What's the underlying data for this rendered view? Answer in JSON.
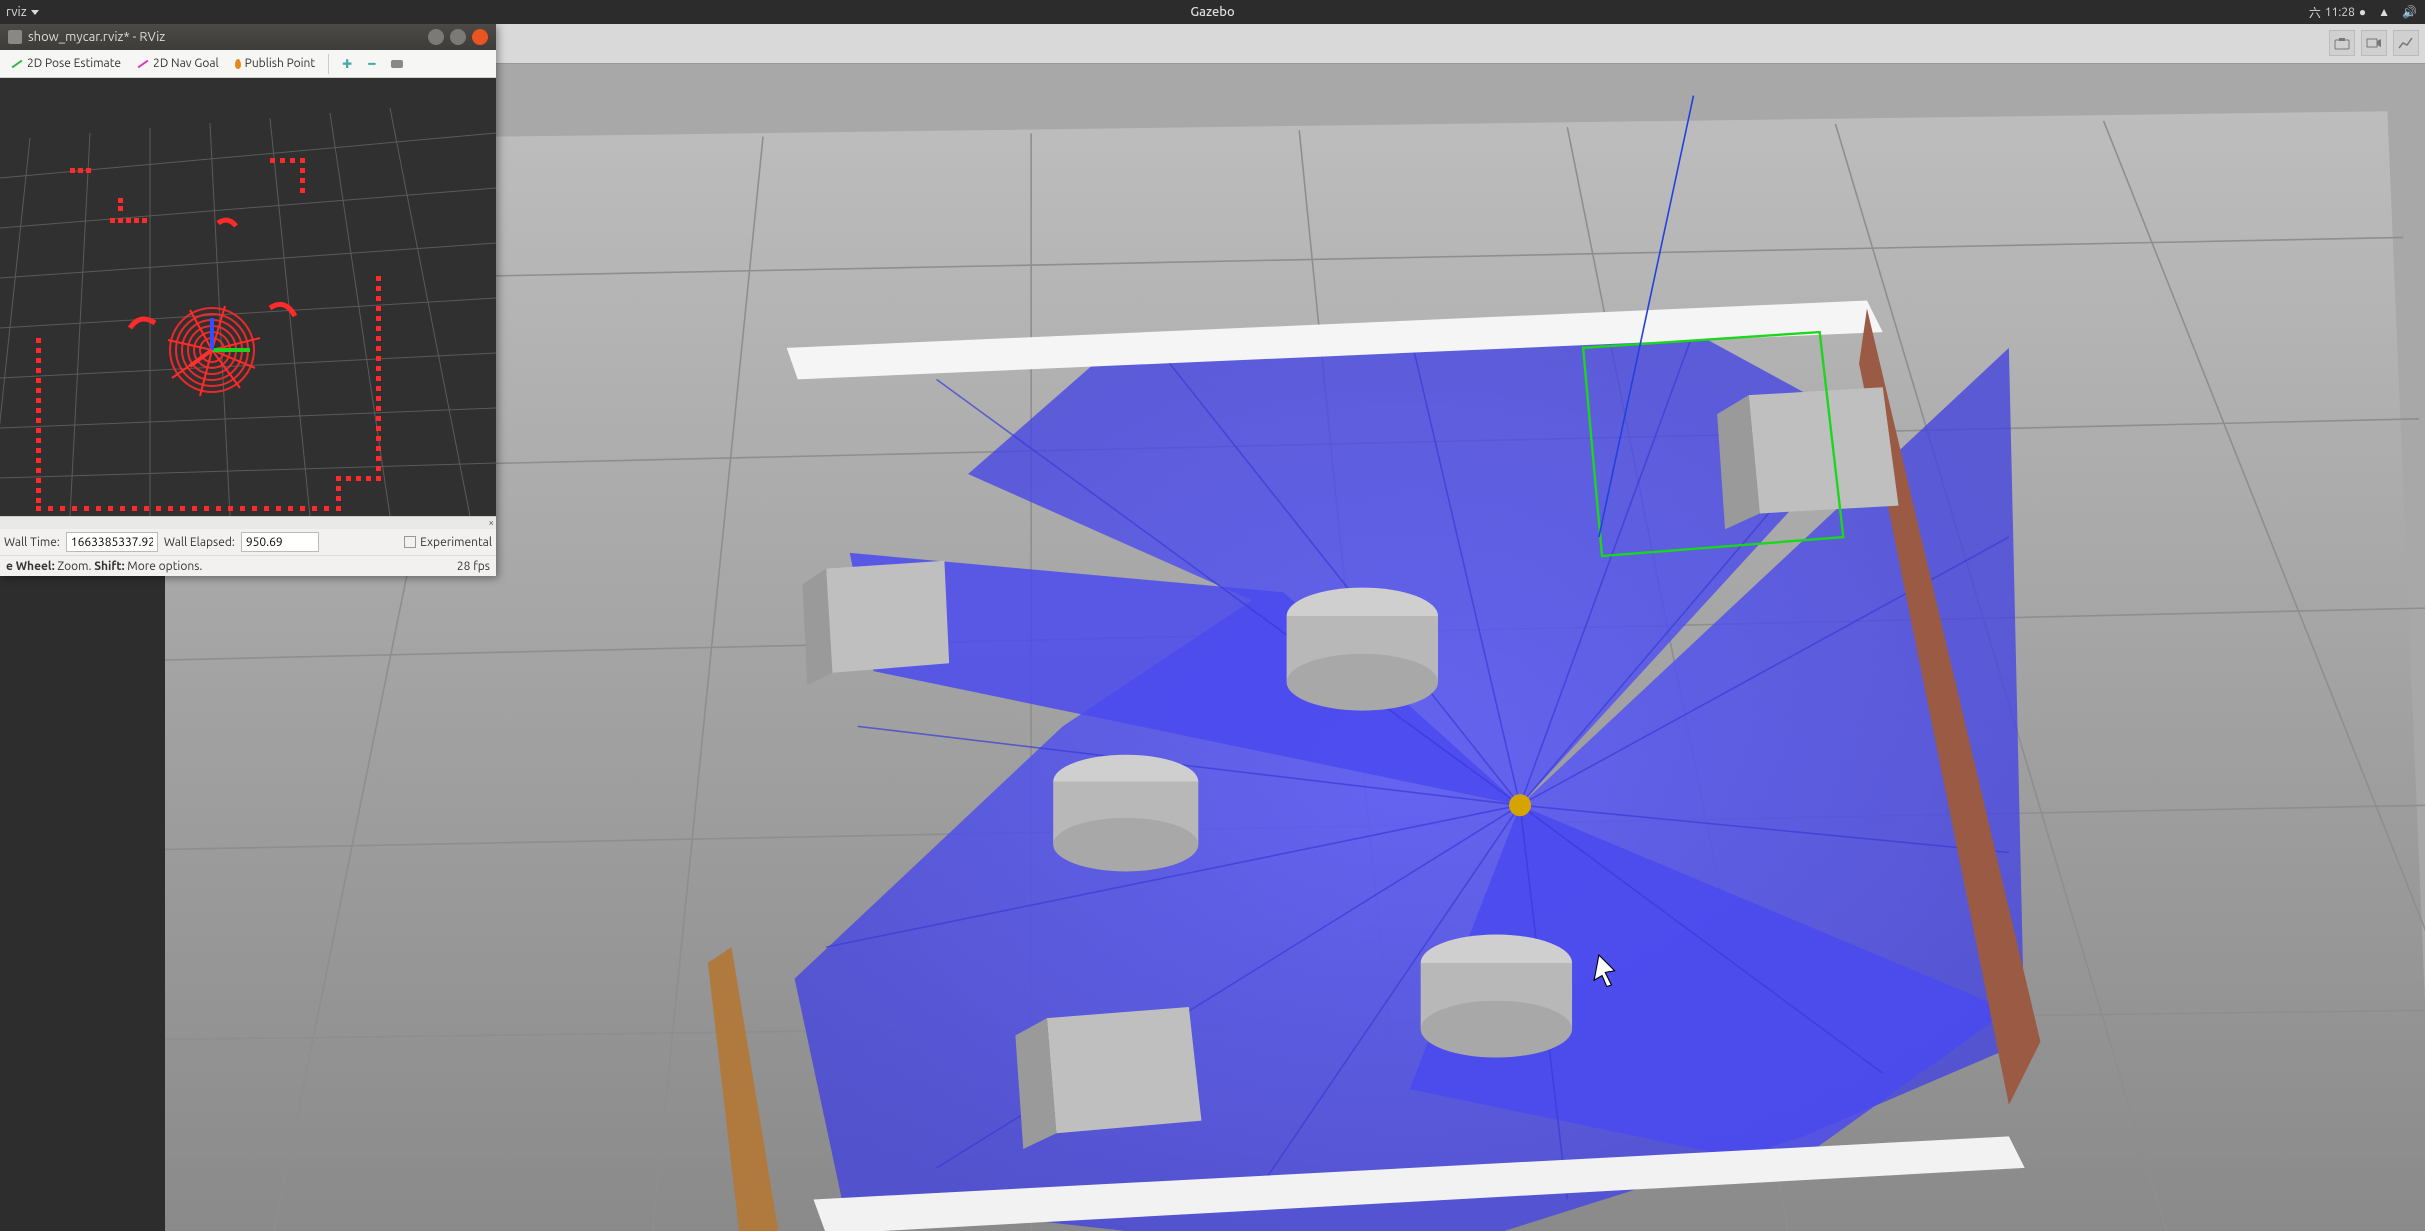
{
  "ubuntu_panel": {
    "app_menu": "rviz",
    "center_app": "Gazebo",
    "clock_day": "六",
    "clock_time": "11:28"
  },
  "gazebo": {
    "toolbar": {
      "icons": [
        "file",
        "save",
        "audio",
        "light"
      ]
    }
  },
  "rviz": {
    "title": "show_mycar.rviz* - RViz",
    "toolbar": {
      "pose_estimate": "2D Pose Estimate",
      "nav_goal": "2D Nav Goal",
      "publish_point": "Publish Point"
    },
    "time": {
      "wall_time_label": "Wall Time:",
      "wall_time_value": "1663385337.92",
      "wall_elapsed_label": "Wall Elapsed:",
      "wall_elapsed_value": "950.69",
      "experimental_label": "Experimental"
    },
    "hint": {
      "text_prefix": "e Wheel:",
      "text_zoom": " Zoom. ",
      "text_shift": "Shift:",
      "text_more": " More options.",
      "fps": "28 fps"
    }
  }
}
